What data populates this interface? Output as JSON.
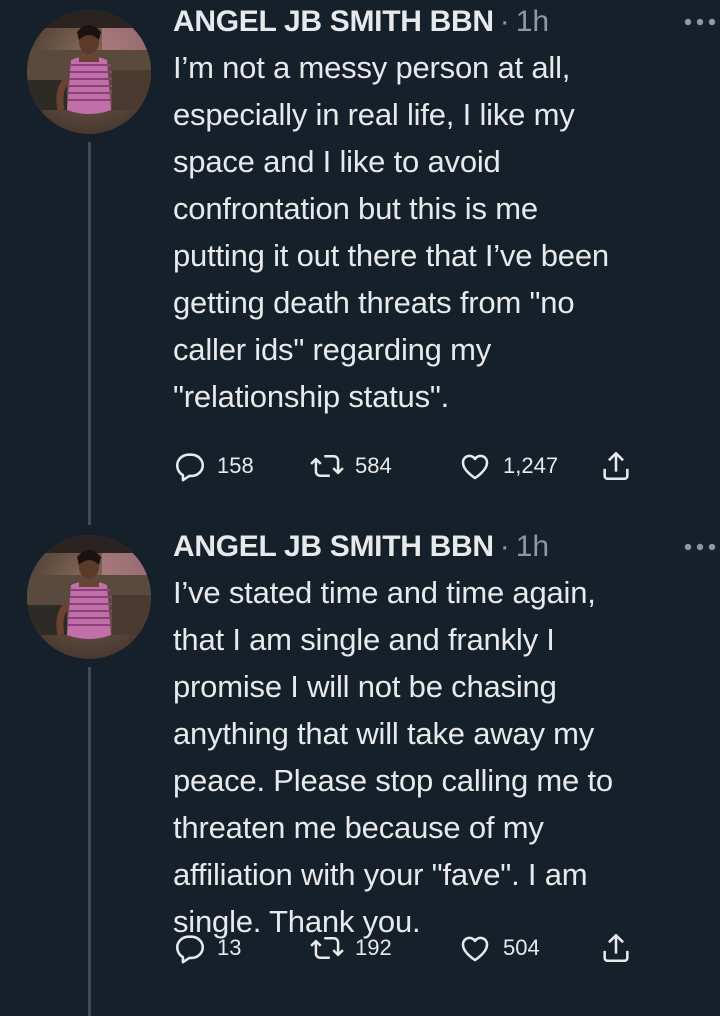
{
  "tweets": [
    {
      "author": "ANGEL JB SMITH BBN",
      "separator": "·",
      "time": "1h",
      "text": "I’m not a messy person at all,\nespecially in real life, I like my\nspace and I like to avoid\nconfrontation but this is me\nputting it out there that I’ve been\ngetting death threats from \"no\ncaller ids\" regarding my\n\"relationship status\".",
      "replies": "158",
      "retweets": "584",
      "likes": "1,247",
      "more_icon": "more-horizontal-icon"
    },
    {
      "author": "ANGEL JB SMITH BBN",
      "separator": "·",
      "time": "1h",
      "text": "I’ve stated time and time again,\nthat I am single and frankly I\npromise I will not be chasing\nanything that will take away my\npeace. Please stop calling me to\nthreaten me because of my\naffiliation with your \"fave\". I am\nsingle. Thank you.",
      "replies": "13",
      "retweets": "192",
      "likes": "504",
      "more_icon": "more-horizontal-icon"
    }
  ],
  "icons": {
    "reply": "reply-icon",
    "retweet": "retweet-icon",
    "like": "heart-icon",
    "share": "share-icon"
  },
  "colors": {
    "background": "#15202b",
    "text": "#e7e9ea",
    "secondary": "#8b98a5",
    "thread_line": "#3e4a55"
  }
}
